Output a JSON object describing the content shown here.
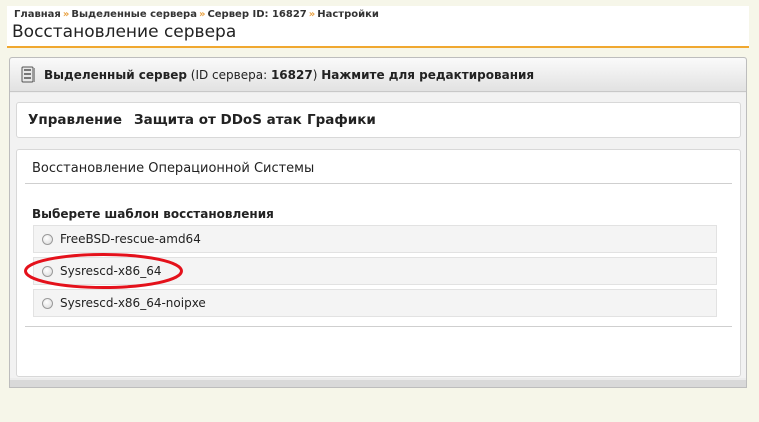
{
  "breadcrumb": {
    "items": [
      "Главная",
      "Выделенные сервера",
      "Сервер ID: 16827",
      "Настройки"
    ],
    "separator": "»"
  },
  "page_title": "Восстановление сервера",
  "panel": {
    "title_bold": "Выделенный сервер",
    "id_prefix": "(ID сервера: ",
    "id_value": "16827",
    "id_suffix": ")",
    "edit_link": "Нажмите для редактирования"
  },
  "tabs": [
    {
      "label": "Управление"
    },
    {
      "label": "Защита от DDoS атак"
    },
    {
      "label": "Графики"
    }
  ],
  "section": {
    "title": "Восстановление Операционной Системы",
    "field_label": "Выберете шаблон восстановления",
    "options": [
      {
        "label": "FreeBSD-rescue-amd64",
        "selected": false
      },
      {
        "label": "Sysrescd-x86_64",
        "selected": false,
        "highlighted": true
      },
      {
        "label": "Sysrescd-x86_64-noipxe",
        "selected": false
      }
    ]
  },
  "colors": {
    "accent_orange": "#f0a830",
    "highlight_red": "#e4111b",
    "background": "#f6f6e9"
  },
  "icons": {
    "server": "server-icon",
    "radio": "radio-icon"
  }
}
